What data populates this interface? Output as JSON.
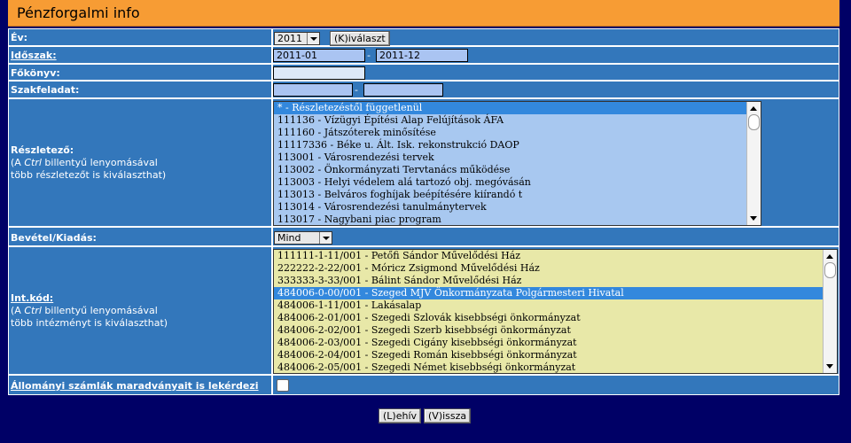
{
  "title": "Pénzforgalmi info",
  "ev": {
    "label": "Év:",
    "value": "2011",
    "button": "(K)iválaszt"
  },
  "idoszak": {
    "label": "Időszak:",
    "from": "2011-01",
    "sep": "-",
    "to": "2011-12"
  },
  "fokonyv": {
    "label": "Főkönyv:",
    "value": ""
  },
  "szakfeladat": {
    "label": "Szakfeladat:",
    "from": "",
    "sep": "-",
    "to": ""
  },
  "reszletezo": {
    "label": "Részletező:",
    "hint1_pre": "(A ",
    "hint1_key": "Ctrl",
    "hint1_post": " billentyű lenyomásával",
    "hint2": "több részletezőt is kiválaszthat)",
    "items": [
      "* - Részletezéstől függetlenül",
      "111136 - Vízügyi Építési Alap Felújítások ÁFA",
      "111160 - Játszóterek minősítése",
      "11117336 - Béke u. Ált. Isk. rekonstrukció DAOP",
      "113001 - Városrendezési tervek",
      "113002 - Önkormányzati Tervtanács működése",
      "113003 - Helyi védelem alá tartozó obj. megóvásán",
      "113013 - Belváros foghíjak beépítésére kiírandó t",
      "113014 - Városrendezési tanulmánytervek",
      "113017 - Nagybani piac program"
    ],
    "selected_index": 0
  },
  "bevetel": {
    "label": "Bevétel/Kiadás:",
    "value": "Mind"
  },
  "intkod": {
    "label": "Int.kód:",
    "hint1_pre": "(A ",
    "hint1_key": "Ctrl",
    "hint1_post": " billentyű lenyomásával",
    "hint2": "több intézményt is kiválaszthat)",
    "items": [
      "111111-1-11/001 - Petőfi Sándor Művelődési Ház",
      "222222-2-22/001 - Móricz Zsigmond Művelődési Ház",
      "333333-3-33/001 - Bálint Sándor Művelődési Ház",
      "484006-0-00/001 - Szeged MJV Önkormányzata Polgármesteri Hivatal",
      "484006-1-11/001 - Lakásalap",
      "484006-2-01/001 - Szegedi Szlovák kisebbségi önkormányzat",
      "484006-2-02/001 - Szegedi Szerb kisebbségi önkormányzat",
      "484006-2-03/001 - Szegedi Cigány kisebbségi önkormányzat",
      "484006-2-04/001 - Szegedi Román kisebbségi önkormányzat",
      "484006-2-05/001 - Szegedi Német kisebbségi önkormányzat"
    ],
    "selected_index": 3
  },
  "allomanyi": {
    "label": "Állományi számlák maradványait is lekérdezi",
    "checked": false
  },
  "buttons": {
    "lehiv": "(L)ehív",
    "vissza": "(V)issza"
  },
  "colors": {
    "title_bg": "#f79c34",
    "page_bg": "#000066",
    "cell_bg": "#3377bb",
    "list1_bg": "#a8c8f0",
    "list2_bg": "#e8e8a8",
    "selected": "#3388dd"
  }
}
